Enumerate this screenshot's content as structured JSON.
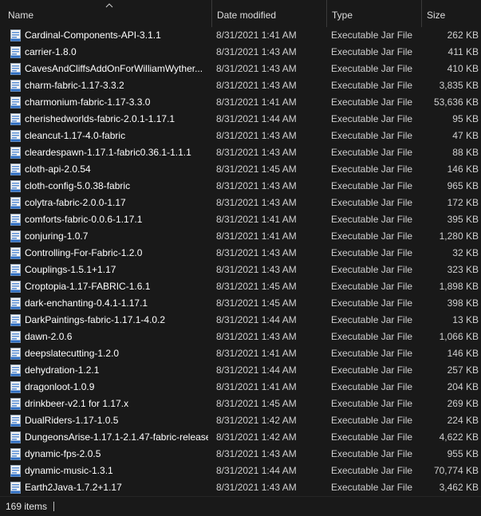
{
  "columns": {
    "name": "Name",
    "date_modified": "Date modified",
    "type": "Type",
    "size": "Size"
  },
  "sort": {
    "column": "name",
    "direction": "ascending",
    "icon": "chevron-up-icon"
  },
  "file_icon": "jar-file-icon",
  "files": [
    {
      "name": "Cardinal-Components-API-3.1.1",
      "date": "8/31/2021 1:41 AM",
      "type": "Executable Jar File",
      "size": "262 KB"
    },
    {
      "name": "carrier-1.8.0",
      "date": "8/31/2021 1:43 AM",
      "type": "Executable Jar File",
      "size": "411 KB"
    },
    {
      "name": "CavesAndCliffsAddOnForWilliamWyther...",
      "date": "8/31/2021 1:43 AM",
      "type": "Executable Jar File",
      "size": "410 KB"
    },
    {
      "name": "charm-fabric-1.17-3.3.2",
      "date": "8/31/2021 1:43 AM",
      "type": "Executable Jar File",
      "size": "3,835 KB"
    },
    {
      "name": "charmonium-fabric-1.17-3.3.0",
      "date": "8/31/2021 1:41 AM",
      "type": "Executable Jar File",
      "size": "53,636 KB"
    },
    {
      "name": "cherishedworlds-fabric-2.0.1-1.17.1",
      "date": "8/31/2021 1:44 AM",
      "type": "Executable Jar File",
      "size": "95 KB"
    },
    {
      "name": "cleancut-1.17-4.0-fabric",
      "date": "8/31/2021 1:43 AM",
      "type": "Executable Jar File",
      "size": "47 KB"
    },
    {
      "name": "cleardespawn-1.17.1-fabric0.36.1-1.1.1",
      "date": "8/31/2021 1:43 AM",
      "type": "Executable Jar File",
      "size": "88 KB"
    },
    {
      "name": "cloth-api-2.0.54",
      "date": "8/31/2021 1:45 AM",
      "type": "Executable Jar File",
      "size": "146 KB"
    },
    {
      "name": "cloth-config-5.0.38-fabric",
      "date": "8/31/2021 1:43 AM",
      "type": "Executable Jar File",
      "size": "965 KB"
    },
    {
      "name": "colytra-fabric-2.0.0-1.17",
      "date": "8/31/2021 1:43 AM",
      "type": "Executable Jar File",
      "size": "172 KB"
    },
    {
      "name": "comforts-fabric-0.0.6-1.17.1",
      "date": "8/31/2021 1:41 AM",
      "type": "Executable Jar File",
      "size": "395 KB"
    },
    {
      "name": "conjuring-1.0.7",
      "date": "8/31/2021 1:41 AM",
      "type": "Executable Jar File",
      "size": "1,280 KB"
    },
    {
      "name": "Controlling-For-Fabric-1.2.0",
      "date": "8/31/2021 1:43 AM",
      "type": "Executable Jar File",
      "size": "32 KB"
    },
    {
      "name": "Couplings-1.5.1+1.17",
      "date": "8/31/2021 1:43 AM",
      "type": "Executable Jar File",
      "size": "323 KB"
    },
    {
      "name": "Croptopia-1.17-FABRIC-1.6.1",
      "date": "8/31/2021 1:45 AM",
      "type": "Executable Jar File",
      "size": "1,898 KB"
    },
    {
      "name": "dark-enchanting-0.4.1-1.17.1",
      "date": "8/31/2021 1:45 AM",
      "type": "Executable Jar File",
      "size": "398 KB"
    },
    {
      "name": "DarkPaintings-fabric-1.17.1-4.0.2",
      "date": "8/31/2021 1:44 AM",
      "type": "Executable Jar File",
      "size": "13 KB"
    },
    {
      "name": "dawn-2.0.6",
      "date": "8/31/2021 1:43 AM",
      "type": "Executable Jar File",
      "size": "1,066 KB"
    },
    {
      "name": "deepslatecutting-1.2.0",
      "date": "8/31/2021 1:41 AM",
      "type": "Executable Jar File",
      "size": "146 KB"
    },
    {
      "name": "dehydration-1.2.1",
      "date": "8/31/2021 1:44 AM",
      "type": "Executable Jar File",
      "size": "257 KB"
    },
    {
      "name": "dragonloot-1.0.9",
      "date": "8/31/2021 1:41 AM",
      "type": "Executable Jar File",
      "size": "204 KB"
    },
    {
      "name": "drinkbeer-v2.1 for 1.17.x",
      "date": "8/31/2021 1:45 AM",
      "type": "Executable Jar File",
      "size": "269 KB"
    },
    {
      "name": "DualRiders-1.17-1.0.5",
      "date": "8/31/2021 1:42 AM",
      "type": "Executable Jar File",
      "size": "224 KB"
    },
    {
      "name": "DungeonsArise-1.17.1-2.1.47-fabric-release",
      "date": "8/31/2021 1:42 AM",
      "type": "Executable Jar File",
      "size": "4,622 KB"
    },
    {
      "name": "dynamic-fps-2.0.5",
      "date": "8/31/2021 1:43 AM",
      "type": "Executable Jar File",
      "size": "955 KB"
    },
    {
      "name": "dynamic-music-1.3.1",
      "date": "8/31/2021 1:44 AM",
      "type": "Executable Jar File",
      "size": "70,774 KB"
    },
    {
      "name": "Earth2Java-1.7.2+1.17",
      "date": "8/31/2021 1:43 AM",
      "type": "Executable Jar File",
      "size": "3,462 KB"
    }
  ],
  "status": {
    "item_count": "169 items"
  }
}
